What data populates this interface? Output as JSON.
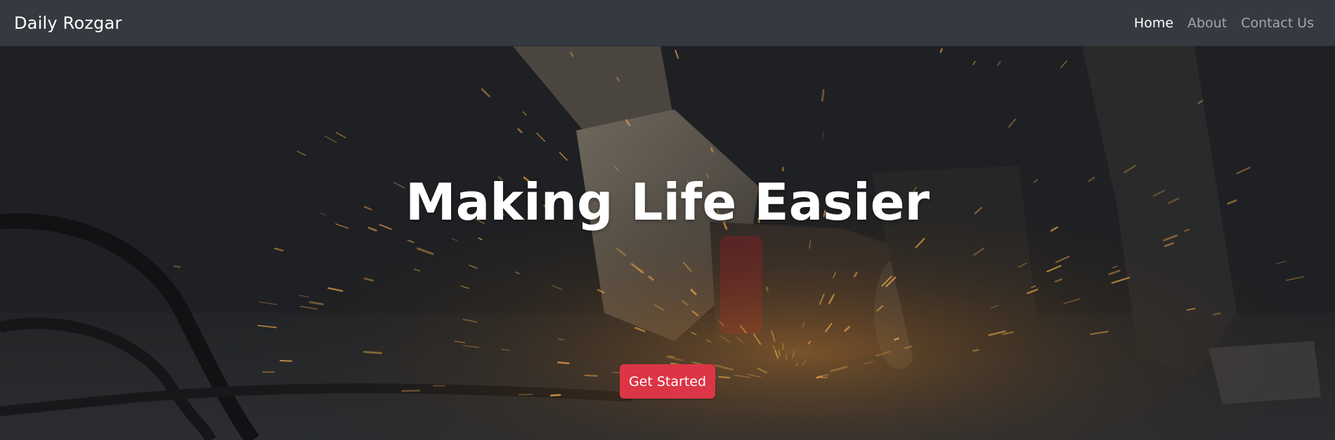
{
  "navbar": {
    "brand": "Daily Rozgar",
    "links": [
      {
        "label": "Home",
        "active": true
      },
      {
        "label": "About",
        "active": false
      },
      {
        "label": "Contact Us",
        "active": false
      }
    ]
  },
  "hero": {
    "title": "Making Life Easier",
    "cta_label": "Get Started",
    "background": "photo of a worker using an angle grinder with sparks"
  },
  "colors": {
    "navbar": "#343a40",
    "cta": "#dc3545",
    "text": "#ffffff"
  }
}
